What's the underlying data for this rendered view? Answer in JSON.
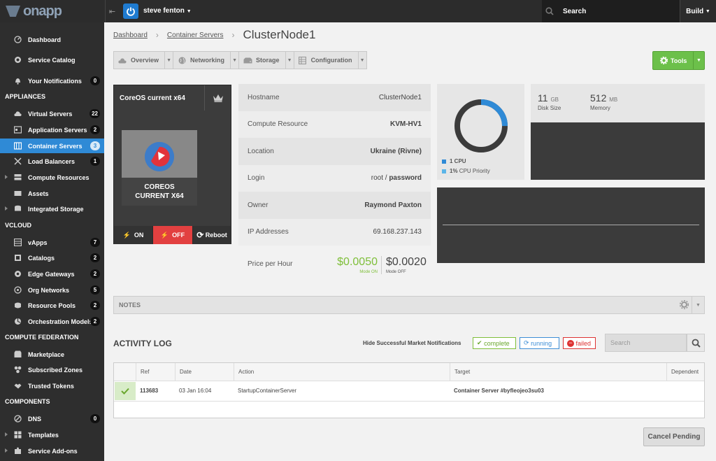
{
  "topbar": {
    "logo_text": "onapp",
    "user": "steve fenton",
    "search_label": "Search",
    "build_label": "Build"
  },
  "sidebar": {
    "top_items": [
      {
        "label": "Dashboard",
        "icon": "dashboard-icon"
      },
      {
        "label": "Service Catalog",
        "icon": "catalog-icon"
      },
      {
        "label": "Your Notifications",
        "icon": "bell-icon",
        "badge": "0"
      }
    ],
    "sections": [
      {
        "title": "APPLIANCES",
        "items": [
          {
            "label": "Virtual Servers",
            "badge": "22"
          },
          {
            "label": "Application Servers",
            "badge": "2"
          },
          {
            "label": "Container Servers",
            "badge": "3",
            "active": true
          },
          {
            "label": "Load Balancers",
            "badge": "1"
          },
          {
            "label": "Compute Resources",
            "badge": ""
          },
          {
            "label": "Assets",
            "badge": ""
          },
          {
            "label": "Integrated Storage",
            "badge": ""
          }
        ]
      },
      {
        "title": "VCLOUD",
        "items": [
          {
            "label": "vApps",
            "badge": "7"
          },
          {
            "label": "Catalogs",
            "badge": "2"
          },
          {
            "label": "Edge Gateways",
            "badge": "2"
          },
          {
            "label": "Org Networks",
            "badge": "5"
          },
          {
            "label": "Resource Pools",
            "badge": "2"
          },
          {
            "label": "Orchestration Models",
            "badge": "2"
          }
        ]
      },
      {
        "title": "COMPUTE FEDERATION",
        "items": [
          {
            "label": "Marketplace",
            "badge": ""
          },
          {
            "label": "Subscribed Zones",
            "badge": ""
          },
          {
            "label": "Trusted Tokens",
            "badge": ""
          }
        ]
      },
      {
        "title": "COMPONENTS",
        "items": [
          {
            "label": "DNS",
            "badge": "0"
          },
          {
            "label": "Templates",
            "badge": ""
          },
          {
            "label": "Service Add-ons",
            "badge": ""
          }
        ]
      }
    ]
  },
  "breadcrumb": {
    "items": [
      "Dashboard",
      "Container Servers"
    ],
    "current": "ClusterNode1"
  },
  "tabs": [
    "Overview",
    "Networking",
    "Storage",
    "Configuration"
  ],
  "tools_label": "Tools",
  "server_card": {
    "title": "CoreOS current x64",
    "os_label_1": "COREOS",
    "os_label_2": "CURRENT X64",
    "on": "ON",
    "off": "OFF",
    "reboot": "Reboot"
  },
  "details": [
    {
      "key": "Hostname",
      "value": "ClusterNode1",
      "bold": false
    },
    {
      "key": "Compute Resource",
      "value": "KVM-HV1",
      "bold": true
    },
    {
      "key": "Location",
      "value": "Ukraine (Rivne)",
      "bold": true
    },
    {
      "key": "Login",
      "value": "root / ",
      "value2": "password"
    },
    {
      "key": "Owner",
      "value": "Raymond Paxton",
      "bold": true
    },
    {
      "key": "IP Addresses",
      "value": "69.168.237.143",
      "bold": false
    }
  ],
  "price": {
    "label": "Price per Hour",
    "on": "$0.0050",
    "on_mode": "Mode ON",
    "off": "$0.0020",
    "off_mode": "Mode OFF"
  },
  "cpu": {
    "cpu_count": "1 CPU",
    "priority_value": "1%",
    "priority_label": "CPU Priority",
    "usage_fraction": 0.25,
    "colors": {
      "cpu": "#2f8ad6",
      "priority": "#5bb5e8"
    }
  },
  "resources": {
    "disk_value": "11",
    "disk_unit": "GB",
    "disk_label": "Disk Size",
    "mem_value": "512",
    "mem_unit": "MB",
    "mem_label": "Memory"
  },
  "notes_label": "NOTES",
  "activity": {
    "title": "ACTIVITY LOG",
    "hide_label": "Hide Successful Market Notifications",
    "statuses": {
      "complete": "complete",
      "running": "running",
      "failed": "failed"
    },
    "search_placeholder": "Search",
    "columns": [
      "Ref",
      "Date",
      "Action",
      "Target",
      "Dependent"
    ],
    "rows": [
      {
        "ref": "113683",
        "date": "03 Jan 16:04",
        "action": "StartupContainerServer",
        "target": "Container Server #byfleojeo3su03",
        "dependent": ""
      }
    ],
    "cancel_label": "Cancel Pending"
  }
}
